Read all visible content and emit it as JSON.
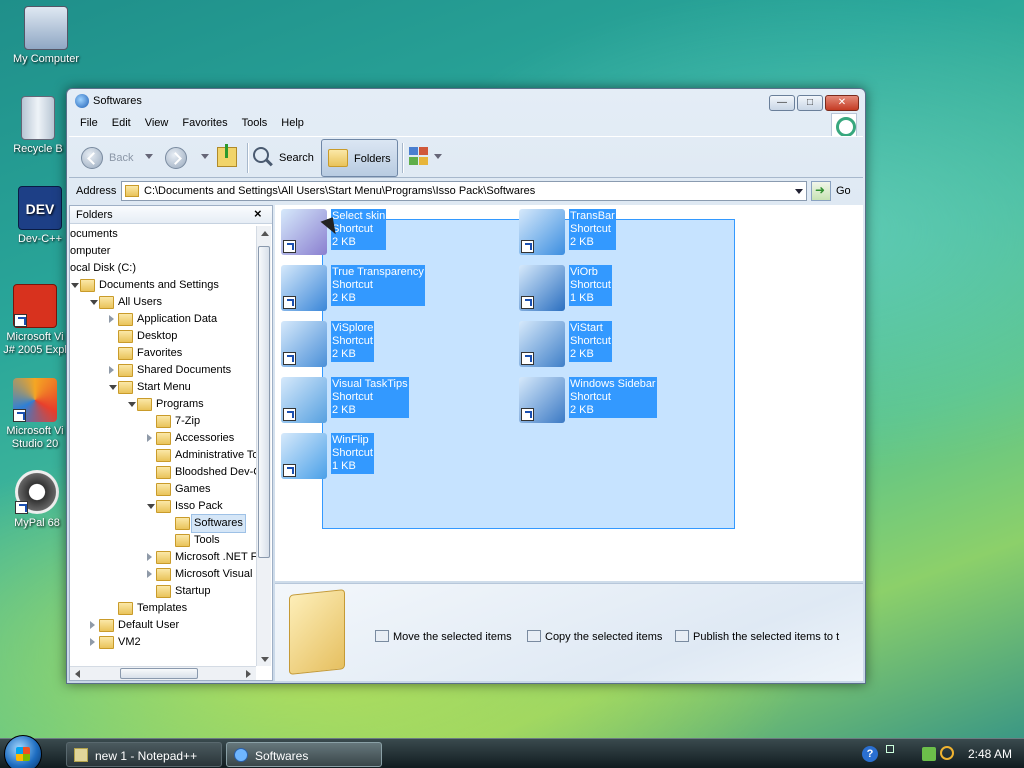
{
  "desktop": {
    "icons": [
      {
        "label": "My Computer"
      },
      {
        "label": "Recycle B"
      },
      {
        "label": "Dev-C++"
      },
      {
        "label": "Microsoft Vi\nJ# 2005 Expl"
      },
      {
        "label": "Microsoft Vi\nStudio 20"
      },
      {
        "label": "MyPal 68"
      }
    ]
  },
  "window": {
    "title": "Softwares",
    "menu": [
      "File",
      "Edit",
      "View",
      "Favorites",
      "Tools",
      "Help"
    ],
    "toolbar": {
      "back_label": "Back",
      "search_label": "Search",
      "folders_label": "Folders"
    },
    "address": {
      "label": "Address",
      "path": "C:\\Documents and Settings\\All Users\\Start Menu\\Programs\\Isso Pack\\Softwares",
      "go_label": "Go"
    },
    "folder_pane": {
      "header": "Folders",
      "close": "×",
      "tree": [
        {
          "label": "ocuments",
          "depth": 0,
          "expander": "none"
        },
        {
          "label": "omputer",
          "depth": 0,
          "expander": "none"
        },
        {
          "label": "ocal Disk (C:)",
          "depth": 0,
          "expander": "none"
        },
        {
          "label": "Documents and Settings",
          "depth": 1,
          "expander": "open"
        },
        {
          "label": "All Users",
          "depth": 2,
          "expander": "open"
        },
        {
          "label": "Application Data",
          "depth": 3,
          "expander": "closed"
        },
        {
          "label": "Desktop",
          "depth": 3,
          "expander": "none"
        },
        {
          "label": "Favorites",
          "depth": 3,
          "expander": "none"
        },
        {
          "label": "Shared Documents",
          "depth": 3,
          "expander": "closed"
        },
        {
          "label": "Start Menu",
          "depth": 3,
          "expander": "open"
        },
        {
          "label": "Programs",
          "depth": 4,
          "expander": "open"
        },
        {
          "label": "7-Zip",
          "depth": 5,
          "expander": "none"
        },
        {
          "label": "Accessories",
          "depth": 5,
          "expander": "closed"
        },
        {
          "label": "Administrative Too",
          "depth": 5,
          "expander": "none"
        },
        {
          "label": "Bloodshed Dev-C+",
          "depth": 5,
          "expander": "none"
        },
        {
          "label": "Games",
          "depth": 5,
          "expander": "none"
        },
        {
          "label": "Isso Pack",
          "depth": 5,
          "expander": "open"
        },
        {
          "label": "Softwares",
          "depth": 6,
          "expander": "none",
          "selected": true
        },
        {
          "label": "Tools",
          "depth": 6,
          "expander": "none"
        },
        {
          "label": "Microsoft .NET Fra",
          "depth": 5,
          "expander": "closed"
        },
        {
          "label": "Microsoft Visual St",
          "depth": 5,
          "expander": "closed"
        },
        {
          "label": "Startup",
          "depth": 5,
          "expander": "none"
        },
        {
          "label": "Templates",
          "depth": 3,
          "expander": "none"
        },
        {
          "label": "Default User",
          "depth": 2,
          "expander": "closed"
        },
        {
          "label": "VM2",
          "depth": 2,
          "expander": "closed"
        }
      ]
    },
    "items": [
      {
        "name": "Select skin",
        "type": "Shortcut",
        "size": "2 KB",
        "icon": "select-skin-icon"
      },
      {
        "name": "TransBar",
        "type": "Shortcut",
        "size": "2 KB",
        "icon": "transbar-icon"
      },
      {
        "name": "True Transparency",
        "type": "Shortcut",
        "size": "2 KB",
        "icon": "true-transparency-icon"
      },
      {
        "name": "ViOrb",
        "type": "Shortcut",
        "size": "1 KB",
        "icon": "viorb-icon"
      },
      {
        "name": "ViSplore",
        "type": "Shortcut",
        "size": "2 KB",
        "icon": "visplore-icon"
      },
      {
        "name": "ViStart",
        "type": "Shortcut",
        "size": "2 KB",
        "icon": "vistart-icon"
      },
      {
        "name": "Visual TaskTips",
        "type": "Shortcut",
        "size": "2 KB",
        "icon": "visual-tasktips-icon"
      },
      {
        "name": "Windows Sidebar",
        "type": "Shortcut",
        "size": "2 KB",
        "icon": "windows-sidebar-icon"
      },
      {
        "name": "WinFlip",
        "type": "Shortcut",
        "size": "1 KB",
        "icon": "winflip-icon"
      }
    ],
    "tasks": [
      {
        "label": "Move the selected items"
      },
      {
        "label": "Copy the selected items"
      },
      {
        "label": "Publish the selected items to t"
      }
    ]
  },
  "taskbar": {
    "buttons": [
      {
        "label": "new 1 - Notepad++"
      },
      {
        "label": "Softwares",
        "active": true
      }
    ],
    "clock": "2:48 AM"
  },
  "colors": {
    "selection": "#3399ff",
    "window_frame": "#c9d8e8",
    "taskbar": "#1a2428"
  }
}
